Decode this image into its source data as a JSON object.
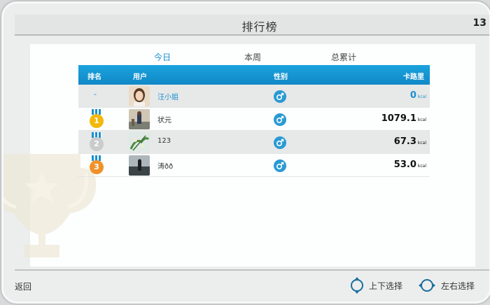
{
  "header": {
    "title": "排行榜",
    "corner_number": "13"
  },
  "tabs": [
    {
      "label": "今日",
      "active": true
    },
    {
      "label": "本周",
      "active": false
    },
    {
      "label": "总累计",
      "active": false
    }
  ],
  "table": {
    "columns": {
      "rank": "排名",
      "user": "用户",
      "gender": "性别",
      "calories": "卡路里"
    },
    "unit": "kcal",
    "rows": [
      {
        "rank": "-",
        "name": "汪小姐",
        "gender": "male",
        "calories": "0"
      },
      {
        "rank": "1",
        "name": "状元",
        "gender": "male",
        "calories": "1079.1"
      },
      {
        "rank": "2",
        "name": "123",
        "gender": "male",
        "calories": "67.3"
      },
      {
        "rank": "3",
        "name": "涛ðð",
        "gender": "male",
        "calories": "53.0"
      }
    ]
  },
  "footer": {
    "back_label": "返回",
    "updown_label": "上下选择",
    "leftright_label": "左右选择"
  },
  "colors": {
    "accent": "#1a8fce",
    "gold": "#f2b90c",
    "silver": "#c9cbcc",
    "bronze": "#f0922a"
  }
}
